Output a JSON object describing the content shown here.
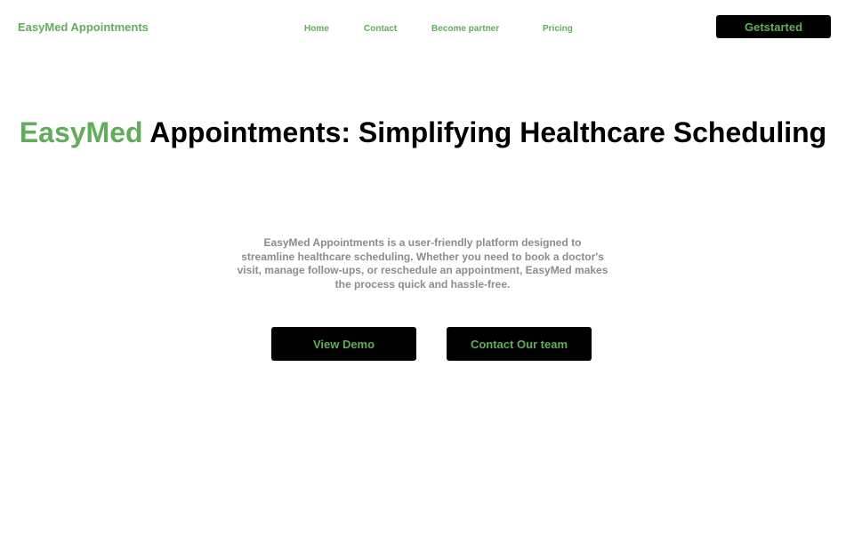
{
  "header": {
    "brand": "EasyMed Appointments",
    "nav": {
      "home": "Home",
      "contact": "Contact",
      "partner": "Become partner",
      "pricing": "Pricing"
    },
    "cta_label": "Getstarted"
  },
  "hero": {
    "title_accent": "EasyMed",
    "title_rest": " Appointments: Simplifying Healthcare Scheduling",
    "description": "EasyMed Appointments is a user-friendly platform designed to streamline healthcare scheduling. Whether you need to book a doctor's visit, manage follow-ups, or reschedule an appointment, EasyMed makes the process quick and hassle-free.",
    "primary_button": "View Demo",
    "secondary_button": "Contact Our team"
  },
  "colors": {
    "accent": "#62ad5b",
    "button_bg": "#000000",
    "muted_text": "#8c8c8c"
  }
}
